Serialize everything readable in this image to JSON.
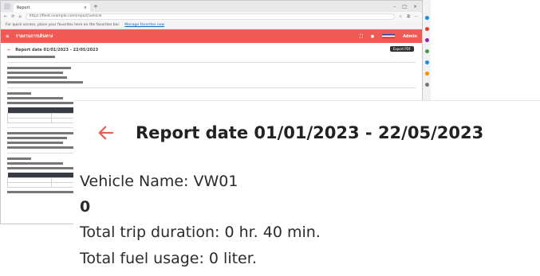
{
  "browser": {
    "tab_title": "Report",
    "url": "https://fleet.example.com/report/vehicle",
    "infobar_text": "For quick access, place your favorites here on the favorites bar.",
    "infobar_link": "Manage favorites now"
  },
  "app": {
    "brand_color": "#ee5b54",
    "title": "รายงานการเดินทาง",
    "user": "Admin",
    "export_label": "Export PDF"
  },
  "report": {
    "title": "Report date 01/01/2023 - 22/05/2023",
    "vehicle_name": "Vehicle Name: VW01",
    "value": "0",
    "trip_duration": "Total trip duration: 0 hr. 40 min.",
    "fuel_usage": "Total fuel usage: 0 liter."
  },
  "icons": {
    "back": "back-arrow-icon",
    "accent_color": "#ee5b54"
  }
}
